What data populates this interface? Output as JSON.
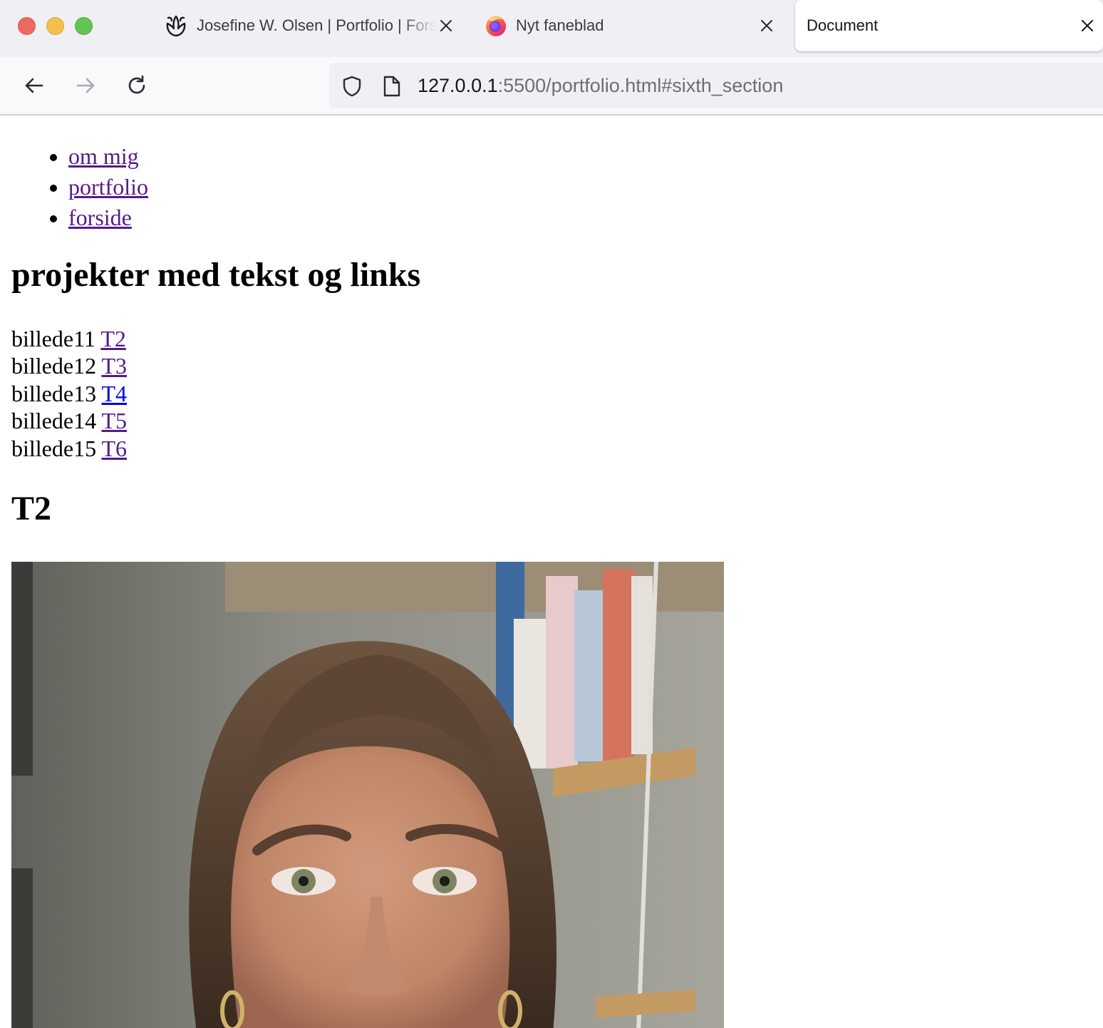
{
  "browser": {
    "tabs": [
      {
        "title": "Josefine W. Olsen | Portfolio | Forside",
        "icon": "flower-logo-icon",
        "active": false
      },
      {
        "title": "Nyt faneblad",
        "icon": "firefox-icon",
        "active": false
      },
      {
        "title": "Document",
        "icon": "",
        "active": true
      }
    ],
    "url_host": "127.0.0.1",
    "url_rest": ":5500/portfolio.html#sixth_section"
  },
  "page": {
    "nav": [
      {
        "label": "om mig"
      },
      {
        "label": "portfolio"
      },
      {
        "label": "forside"
      }
    ],
    "section_title": "projekter med tekst og links",
    "projects": [
      {
        "name": "billede11",
        "link": "T2",
        "visited": true
      },
      {
        "name": "billede12",
        "link": "T3",
        "visited": true
      },
      {
        "name": "billede13",
        "link": "T4",
        "visited": false
      },
      {
        "name": "billede14",
        "link": "T5",
        "visited": true
      },
      {
        "name": "billede15",
        "link": "T6",
        "visited": true
      }
    ],
    "t2_heading": "T2"
  },
  "colors": {
    "link_visited": "#551a8b",
    "link_unvisited": "#0000ee",
    "tabstrip_bg": "#f0f0f4",
    "toolbar_bg": "#f9f9fb"
  }
}
